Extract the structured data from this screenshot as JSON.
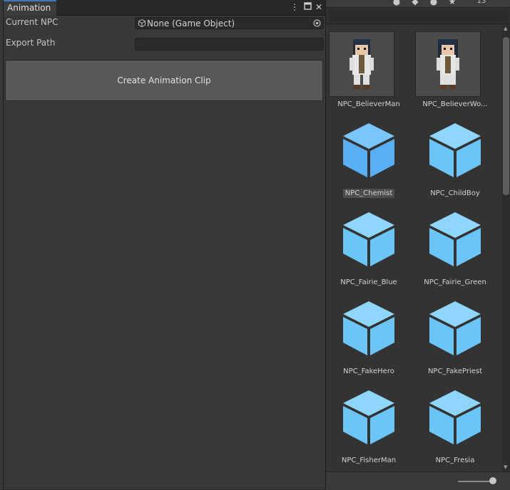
{
  "animation_window": {
    "tab_label": "Animation",
    "menu_icon": "more-vert-icon",
    "maximize_icon": "maximize-icon",
    "close_icon": "close-icon",
    "current_npc_label": "Current NPC",
    "current_npc_value": "None (Game Object)",
    "export_path_label": "Export Path",
    "export_path_value": "",
    "create_button_label": "Create Animation Clip"
  },
  "project_toolbar": {
    "icons": [
      "layers-icon",
      "label-icon",
      "info-icon",
      "star-icon",
      "hidden-icon"
    ],
    "hidden_count": "13"
  },
  "assets": [
    {
      "label": "NPC_BelieverMan",
      "kind": "sprite",
      "selected": false
    },
    {
      "label": "NPC_BelieverWo...",
      "kind": "sprite",
      "selected": false
    },
    {
      "label": "NPC_Chemist",
      "kind": "prefab",
      "selected": true
    },
    {
      "label": "NPC_ChildBoy",
      "kind": "prefab",
      "selected": false
    },
    {
      "label": "NPC_Fairie_Blue",
      "kind": "prefab",
      "selected": false
    },
    {
      "label": "NPC_Fairie_Green",
      "kind": "prefab",
      "selected": false
    },
    {
      "label": "NPC_FakeHero",
      "kind": "prefab",
      "selected": false
    },
    {
      "label": "NPC_FakePriest",
      "kind": "prefab",
      "selected": false
    },
    {
      "label": "NPC_FisherMan",
      "kind": "prefab",
      "selected": false
    },
    {
      "label": "NPC_Fresia",
      "kind": "prefab",
      "selected": false
    }
  ],
  "colors": {
    "prefab_cube_light": "#7dcffb",
    "prefab_cube_mid": "#5fb8f4",
    "prefab_cube_selected": "#5ab0f5",
    "tab_accent": "#3a79bb"
  }
}
